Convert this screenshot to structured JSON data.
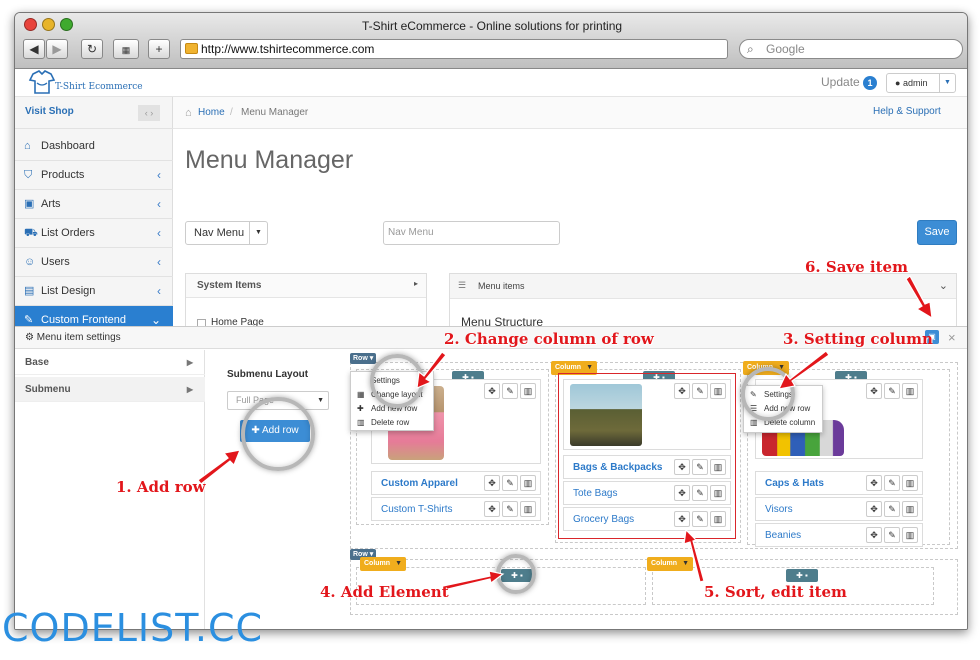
{
  "browser": {
    "window_title": "T-Shirt eCommerce - Online solutions for printing",
    "url": "http://www.tshirtecommerce.com",
    "search_placeholder": "Google",
    "colors": {
      "close": "#e8433b",
      "minimize": "#e7b42a",
      "zoom": "#3faa2e"
    }
  },
  "app": {
    "logo_text": "T-Shirt Ecommerce",
    "update_label": "Update",
    "update_count": "1",
    "user_label": "admin"
  },
  "sidebar": {
    "visit_shop": "Visit Shop",
    "items": [
      {
        "label": "Dashboard",
        "icon": "dashboard-icon"
      },
      {
        "label": "Products",
        "icon": "tshirt-icon"
      },
      {
        "label": "Arts",
        "icon": "image-icon"
      },
      {
        "label": "List Orders",
        "icon": "cart-icon"
      },
      {
        "label": "Users",
        "icon": "users-icon"
      },
      {
        "label": "List Design",
        "icon": "design-icon"
      },
      {
        "label": "Custom Frontend",
        "icon": "pencil-icon"
      }
    ]
  },
  "content": {
    "breadcrumb_home": "Home",
    "breadcrumb_current": "Menu Manager",
    "help_link": "Help & Support",
    "page_title": "Menu Manager",
    "menu_select": "Nav Menu",
    "menu_name_placeholder": "Nav Menu",
    "save_label": "Save",
    "system_items_title": "System Items",
    "system_item_home": "Home Page",
    "menu_items_title": "Menu items",
    "menu_structure_title": "Menu Structure"
  },
  "settings_modal": {
    "title": "Menu item settings",
    "sections": [
      "Base",
      "Submenu"
    ],
    "submenu_layout_label": "Submenu Layout",
    "layout_value": "Full Page",
    "add_row_label": "Add row",
    "row_label": "Row",
    "column_label": "Column",
    "context_menu": [
      "Settings",
      "Change layout",
      "Add new row",
      "Delete row"
    ],
    "column_menu": [
      "Settings",
      "Add new row",
      "Delete column"
    ],
    "column1_items": [
      "Custom Apparel",
      "Custom T-Shirts"
    ],
    "column2_items": [
      "Bags & Backpacks",
      "Tote Bags",
      "Grocery Bags"
    ],
    "column3_items": [
      "Caps & Hats",
      "Visors",
      "Beanies"
    ]
  },
  "annotations": {
    "a1": "1. Add row",
    "a2": "2. Change column of row",
    "a3": "3. Setting column",
    "a4": "4. Add Element",
    "a5": "5. Sort, edit item",
    "a6": "6. Save item"
  },
  "watermark": "CODELIST.CC"
}
